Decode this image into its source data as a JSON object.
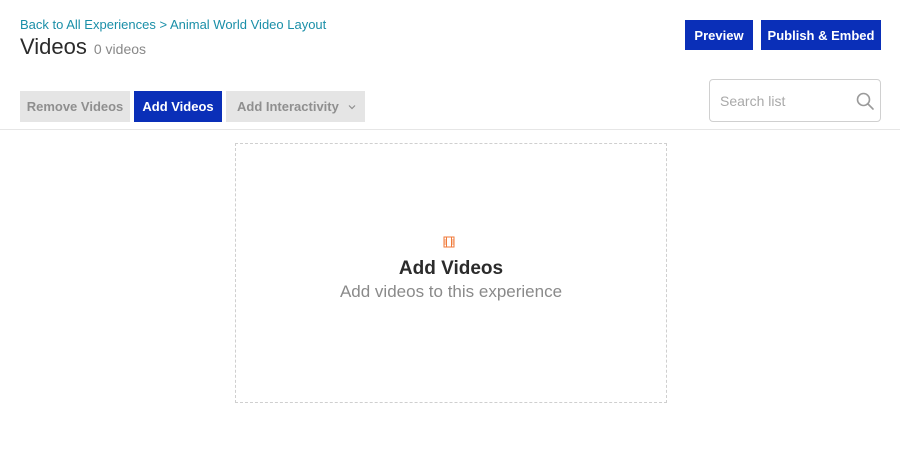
{
  "breadcrumb": "Back to All Experiences > Animal World Video Layout",
  "header": {
    "title": "Videos",
    "count": "0 videos"
  },
  "top_actions": {
    "preview": "Preview",
    "publish": "Publish & Embed"
  },
  "toolbar": {
    "remove": "Remove Videos",
    "add": "Add Videos",
    "interactivity": "Add Interactivity"
  },
  "search": {
    "placeholder": "Search list",
    "value": ""
  },
  "empty_state": {
    "title": "Add Videos",
    "subtitle": "Add videos to this experience",
    "icon": "film-icon"
  },
  "colors": {
    "primary": "#0a2fb8",
    "link": "#1a8fa8",
    "accent_icon": "#f07a3a",
    "disabled_bg": "#e5e5e5"
  }
}
